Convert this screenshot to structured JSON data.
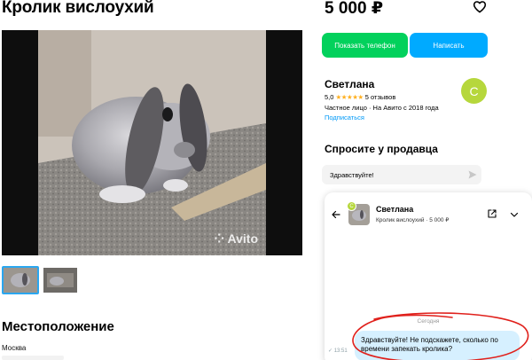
{
  "listing": {
    "title": "Кролик вислоухий",
    "price": "5 000 ₽",
    "photo_watermark": "Avito"
  },
  "actions": {
    "show_phone": "Показать телефон",
    "write": "Написать"
  },
  "seller": {
    "name": "Светлана",
    "rating": "5,0",
    "stars": "★★★★★",
    "reviews": "5 отзывов",
    "type": "Частное лицо · На Авито с 2018 года",
    "subscribe": "Подписаться",
    "avatar_letter": "С",
    "avatar_color": "#b6d73c"
  },
  "ask": {
    "heading": "Спросите у продавца",
    "message": "Здравствуйте!"
  },
  "location": {
    "heading": "Местоположение",
    "city": "Москва"
  },
  "chat": {
    "contact_name": "Светлана",
    "item": "Кролик вислоухий · 5 000 ₽",
    "day_label": "Сегодня",
    "message_time": "13:51",
    "message_text": "Здравствуйте! Не подскажете, сколько по времени запекать кролика?"
  },
  "colors": {
    "phone_button": "#02d15c",
    "write_button": "#00aaff",
    "accent_link": "#0099f7",
    "bubble": "#d6f0ff",
    "annotation": "#e0201b"
  },
  "icons": {
    "favorite": "heart-icon",
    "send": "send-icon",
    "back": "arrow-left-icon",
    "open_external": "external-link-icon",
    "collapse": "chevron-down-icon"
  }
}
